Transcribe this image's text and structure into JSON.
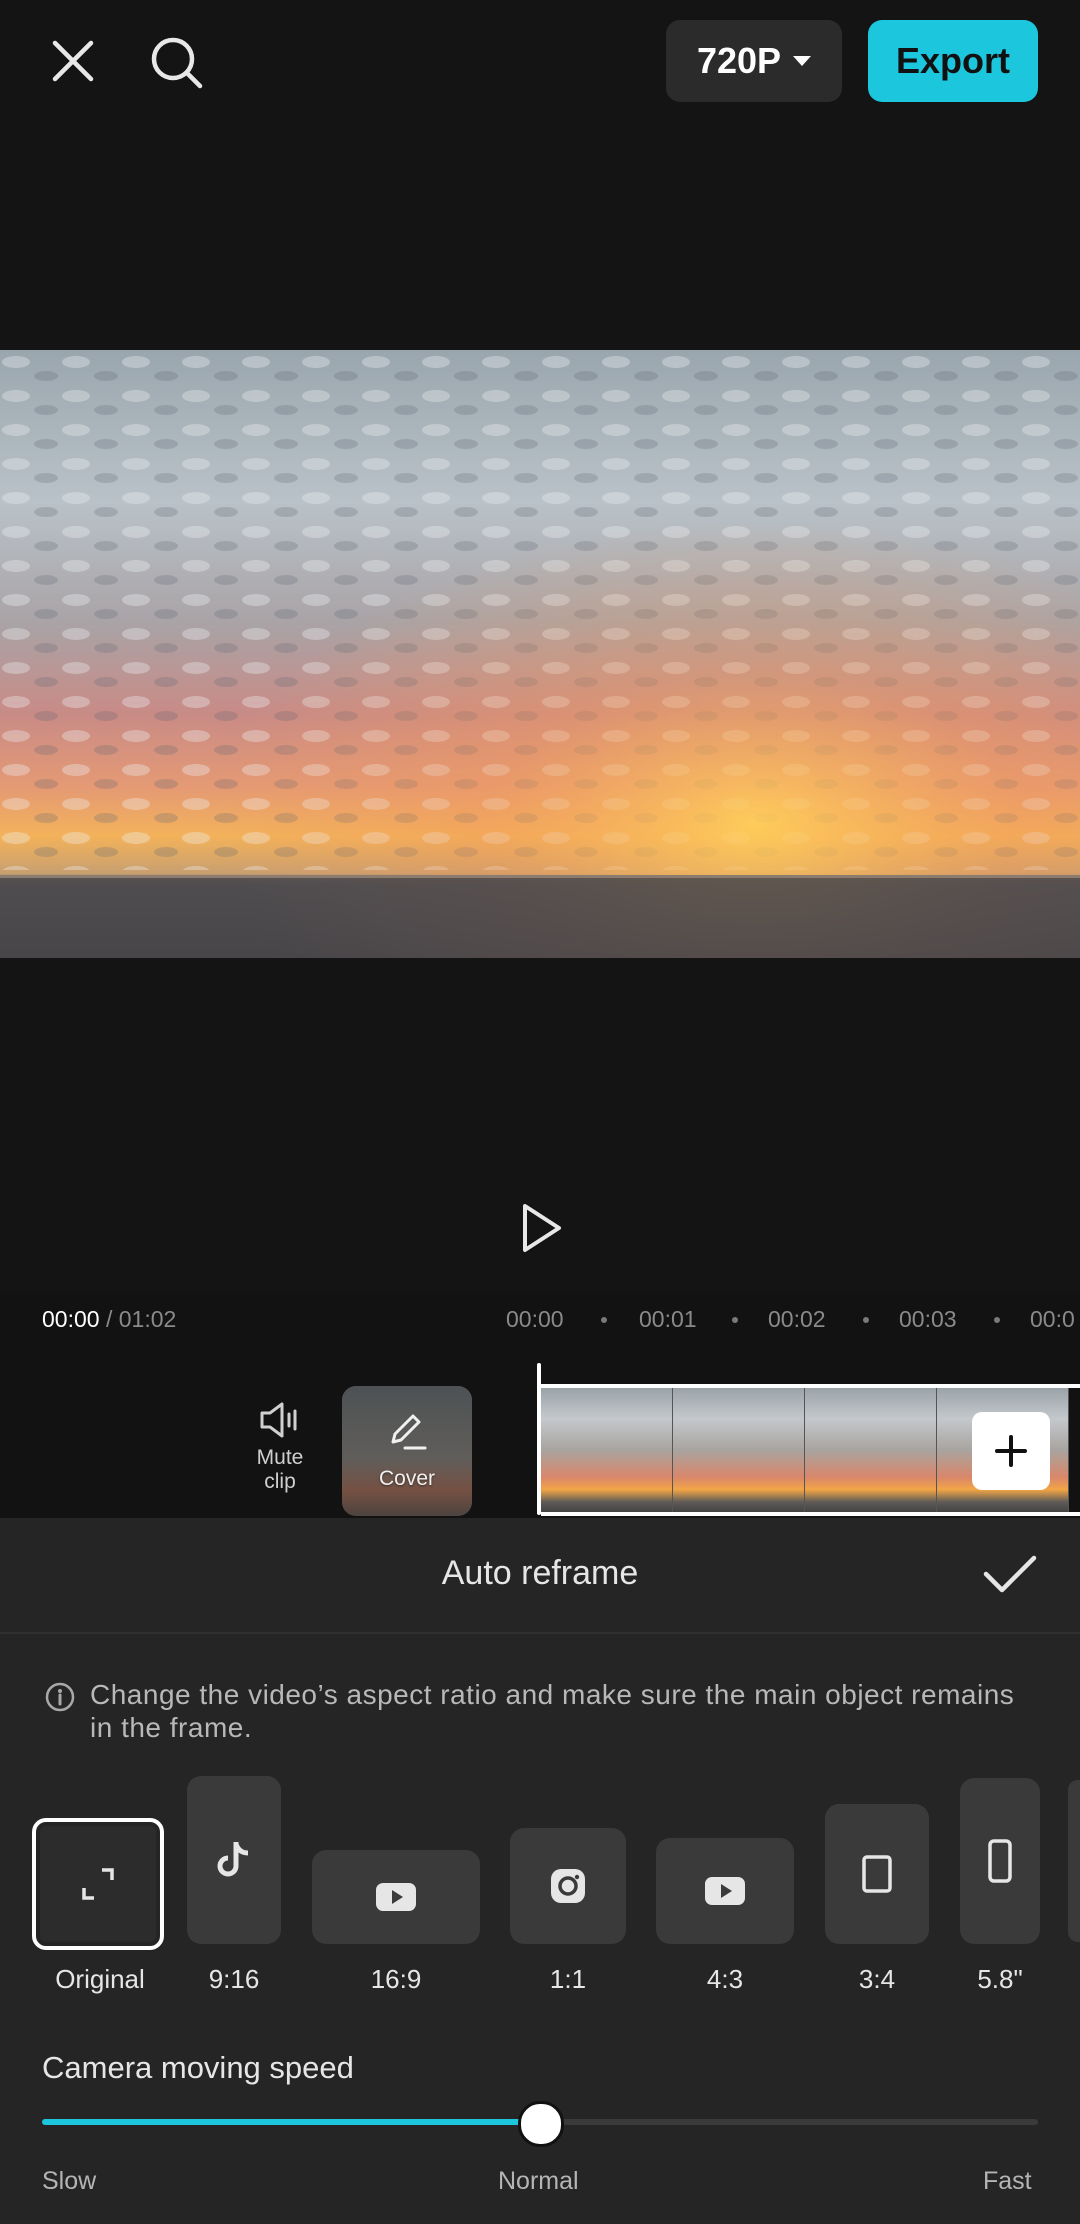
{
  "topbar": {
    "resolution": "720P",
    "export_label": "Export"
  },
  "player": {
    "current_time": "00:00",
    "total_time": "/ 01:02"
  },
  "ruler": [
    "00:00",
    "00:01",
    "00:02",
    "00:03",
    "00:0"
  ],
  "track": {
    "mute_label": "Mute clip",
    "cover_label": "Cover"
  },
  "panel": {
    "title": "Auto reframe",
    "info": "Change the video’s aspect ratio and make sure the main object remains in the frame.",
    "ratios": [
      {
        "label": "Original",
        "icon": "reframe-corners-icon",
        "selected": true
      },
      {
        "label": "9:16",
        "icon": "tiktok-icon"
      },
      {
        "label": "16:9",
        "icon": "youtube-icon"
      },
      {
        "label": "1:1",
        "icon": "instagram-icon"
      },
      {
        "label": "4:3",
        "icon": "youtube-icon"
      },
      {
        "label": "3:4",
        "icon": "portrait-rect-icon"
      },
      {
        "label": "5.8\"",
        "icon": "phone-rect-icon"
      }
    ],
    "speed_title": "Camera moving speed",
    "speed_labels": {
      "slow": "Slow",
      "normal": "Normal",
      "fast": "Fast"
    },
    "speed_value": "Normal",
    "speed_fraction": 0.5
  },
  "colors": {
    "accent": "#1cc6dc",
    "background": "#141414",
    "panel": "#252525"
  }
}
